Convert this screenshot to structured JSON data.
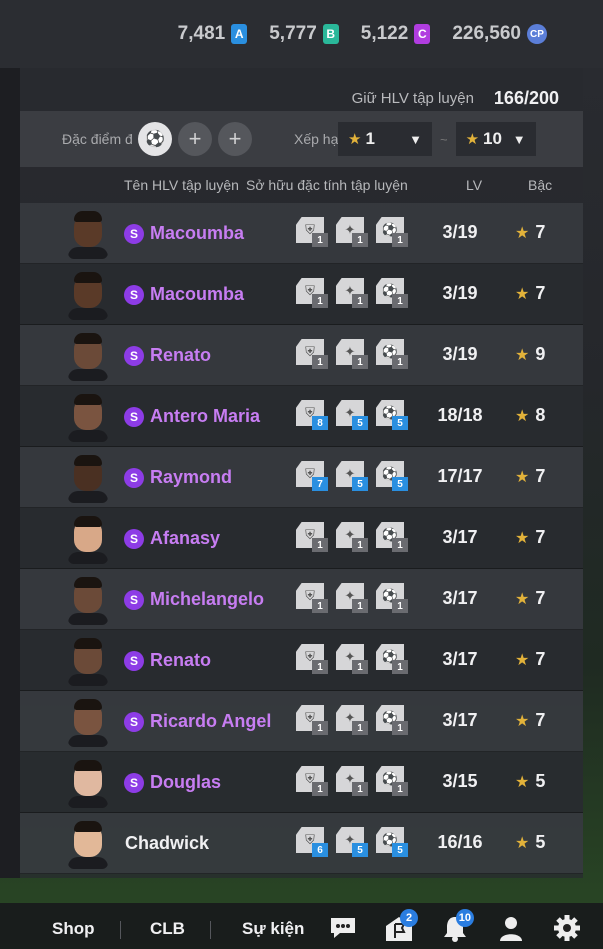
{
  "currencies": [
    {
      "value": "7,481",
      "badge": "A",
      "color": "#2a8fe0"
    },
    {
      "value": "5,777",
      "badge": "B",
      "color": "#2ab89a"
    },
    {
      "value": "5,122",
      "badge": "C",
      "color": "#b13de0"
    },
    {
      "value": "226,560",
      "badge": "CP",
      "color": "#5b7ed8"
    }
  ],
  "capacity": {
    "label": "Giữ HLV tập luyện",
    "value": "166/200"
  },
  "filters": {
    "trait_label": "Đặc điểm đ",
    "rank_label": "Xếp hạ",
    "rank_from": "1",
    "rank_to": "10",
    "tilde": "~"
  },
  "columns": {
    "name": "Tên HLV tập luyện",
    "traits": "Sở hữu đặc tính tập luyện",
    "lv": "LV",
    "grade": "Bậc"
  },
  "coaches": [
    {
      "name": "Macoumba",
      "special": true,
      "lv": "3/19",
      "grade": "7",
      "skin": "#5a3a28",
      "traits": [
        {
          "lvl": "1",
          "hi": false
        },
        {
          "lvl": "1",
          "hi": false
        },
        {
          "lvl": "1",
          "hi": false
        }
      ]
    },
    {
      "name": "Macoumba",
      "special": true,
      "lv": "3/19",
      "grade": "7",
      "skin": "#5a3a28",
      "traits": [
        {
          "lvl": "1",
          "hi": false
        },
        {
          "lvl": "1",
          "hi": false
        },
        {
          "lvl": "1",
          "hi": false
        }
      ]
    },
    {
      "name": "Renato",
      "special": true,
      "lv": "3/19",
      "grade": "9",
      "skin": "#6b4a38",
      "traits": [
        {
          "lvl": "1",
          "hi": false
        },
        {
          "lvl": "1",
          "hi": false
        },
        {
          "lvl": "1",
          "hi": false
        }
      ]
    },
    {
      "name": "Antero Maria",
      "special": true,
      "lv": "18/18",
      "grade": "8",
      "skin": "#7a5440",
      "traits": [
        {
          "lvl": "8",
          "hi": true
        },
        {
          "lvl": "5",
          "hi": true
        },
        {
          "lvl": "5",
          "hi": true
        }
      ]
    },
    {
      "name": "Raymond",
      "special": true,
      "lv": "17/17",
      "grade": "7",
      "skin": "#4a3022",
      "traits": [
        {
          "lvl": "7",
          "hi": true
        },
        {
          "lvl": "5",
          "hi": true
        },
        {
          "lvl": "5",
          "hi": true
        }
      ]
    },
    {
      "name": "Afanasy",
      "special": true,
      "lv": "3/17",
      "grade": "7",
      "skin": "#d8a888",
      "traits": [
        {
          "lvl": "1",
          "hi": false
        },
        {
          "lvl": "1",
          "hi": false
        },
        {
          "lvl": "1",
          "hi": false
        }
      ]
    },
    {
      "name": "Michelangelo",
      "special": true,
      "lv": "3/17",
      "grade": "7",
      "skin": "#6b4a38",
      "traits": [
        {
          "lvl": "1",
          "hi": false
        },
        {
          "lvl": "1",
          "hi": false
        },
        {
          "lvl": "1",
          "hi": false
        }
      ]
    },
    {
      "name": "Renato",
      "special": true,
      "lv": "3/17",
      "grade": "7",
      "skin": "#6b4a38",
      "traits": [
        {
          "lvl": "1",
          "hi": false
        },
        {
          "lvl": "1",
          "hi": false
        },
        {
          "lvl": "1",
          "hi": false
        }
      ]
    },
    {
      "name": "Ricardo Angel",
      "special": true,
      "lv": "3/17",
      "grade": "7",
      "skin": "#7a5440",
      "traits": [
        {
          "lvl": "1",
          "hi": false
        },
        {
          "lvl": "1",
          "hi": false
        },
        {
          "lvl": "1",
          "hi": false
        }
      ]
    },
    {
      "name": "Douglas",
      "special": true,
      "lv": "3/15",
      "grade": "5",
      "skin": "#e0b8a0",
      "traits": [
        {
          "lvl": "1",
          "hi": false
        },
        {
          "lvl": "1",
          "hi": false
        },
        {
          "lvl": "1",
          "hi": false
        }
      ]
    },
    {
      "name": "Chadwick",
      "special": false,
      "lv": "16/16",
      "grade": "5",
      "skin": "#e2b898",
      "traits": [
        {
          "lvl": "6",
          "hi": true
        },
        {
          "lvl": "5",
          "hi": true
        },
        {
          "lvl": "5",
          "hi": true
        }
      ]
    }
  ],
  "special_badge": "S",
  "nav": {
    "shop": "Shop",
    "club": "CLB",
    "events": "Sự kiện",
    "flag_badge": "2",
    "bell_badge": "10"
  },
  "icons": [
    "chat-icon",
    "flag-icon",
    "bell-icon",
    "profile-icon",
    "settings-icon"
  ]
}
